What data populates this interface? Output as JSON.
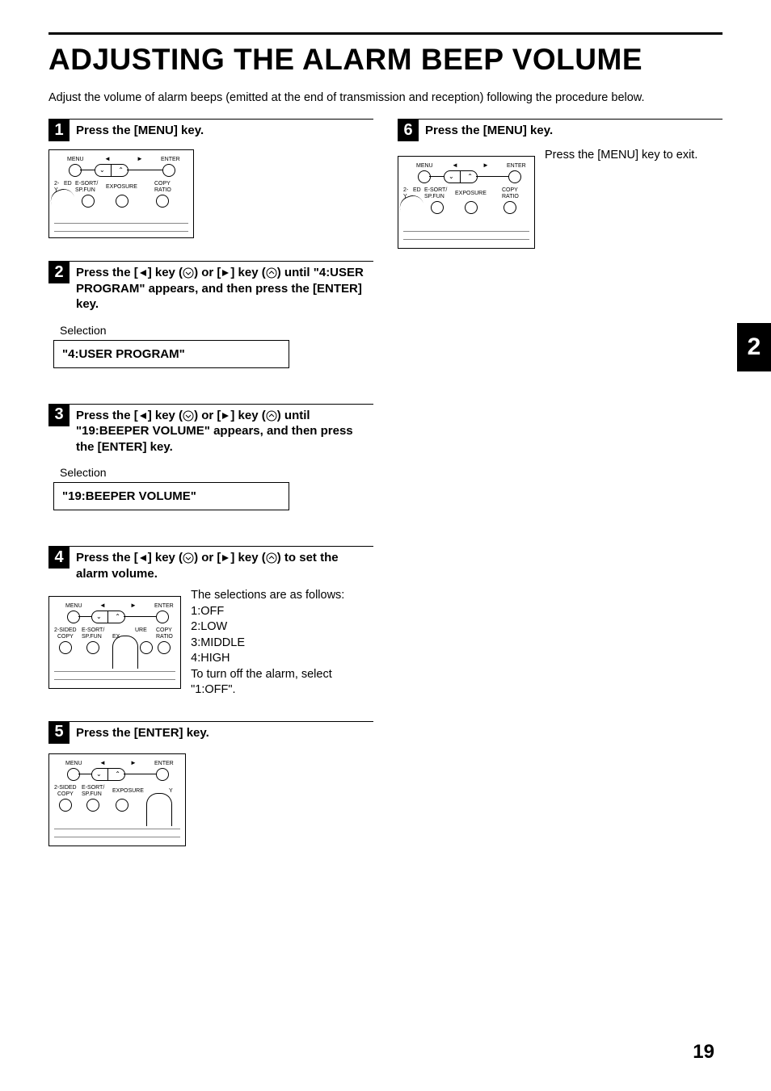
{
  "title": "ADJUSTING THE ALARM BEEP VOLUME",
  "intro": "Adjust the volume of alarm beeps (emitted at the end of transmission and reception) following the procedure below.",
  "side_tab": "2",
  "page_number": "19",
  "panel": {
    "menu": "MENU",
    "enter": "ENTER",
    "twoSided": "2-SIDED",
    "copy": "COPY",
    "esort": "E-SORT/",
    "spfun": "SP.FUN",
    "exposure": "EXPOSURE",
    "copy2": "COPY",
    "ratio": "RATIO",
    "ed": "ED",
    "y": "Y",
    "ure": "URE",
    "ex": "EX"
  },
  "steps": {
    "s1": {
      "num": "1",
      "title": "Press the [MENU] key."
    },
    "s2": {
      "num": "2",
      "title_a": "Press the [",
      "title_b": "] key (",
      "title_c": ") or [",
      "title_d": "] key (",
      "title_e": ") until \"4:USER PROGRAM\" appears, and then press the [ENTER] key.",
      "selection_label": "Selection",
      "display": "\"4:USER PROGRAM\""
    },
    "s3": {
      "num": "3",
      "title_a": "Press the [",
      "title_b": "] key (",
      "title_c": ") or [",
      "title_d": "] key (",
      "title_e": ") until \"19:BEEPER VOLUME\" appears, and then press the [ENTER] key.",
      "selection_label": "Selection",
      "display": "\"19:BEEPER VOLUME\""
    },
    "s4": {
      "num": "4",
      "title_a": "Press the [",
      "title_b": "] key (",
      "title_c": ") or [",
      "title_d": "] key (",
      "title_e": ") to set the alarm volume.",
      "desc_intro": "The selections are as follows:",
      "opt1": "1:OFF",
      "opt2": "2:LOW",
      "opt3": "3:MIDDLE",
      "opt4": "4:HIGH",
      "desc_tail": "To turn off the alarm, select \"1:OFF\"."
    },
    "s5": {
      "num": "5",
      "title": "Press the [ENTER] key."
    },
    "s6": {
      "num": "6",
      "title": "Press the [MENU] key.",
      "desc": "Press the [MENU] key to exit."
    }
  }
}
